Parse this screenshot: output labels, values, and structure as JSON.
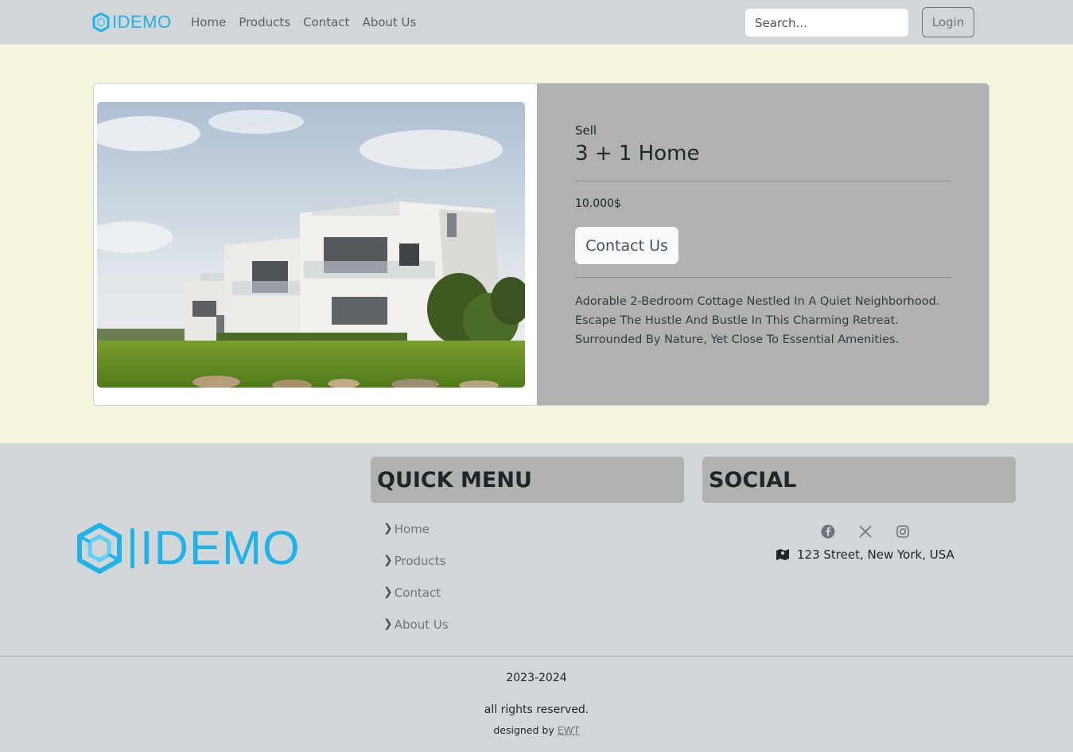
{
  "navbar": {
    "brand": "IDEMO",
    "links": [
      "Home",
      "Products",
      "Contact",
      "About Us"
    ],
    "search_placeholder": "Search...",
    "login_label": "Login"
  },
  "listing": {
    "category": "Sell",
    "title": "3 + 1 Home",
    "price": "10.000$",
    "contact_label": "Contact Us",
    "description": "Adorable 2-Bedroom Cottage Nestled In A Quiet Neighborhood. Escape The Hustle And Bustle In This Charming Retreat. Surrounded By Nature, Yet Close To Essential Amenities."
  },
  "footer": {
    "brand": "IDEMO",
    "quick_menu_title": "QUICK MENU",
    "quick_menu": [
      "Home",
      "Products",
      "Contact",
      "About Us"
    ],
    "social_title": "SOCIAL",
    "social_icons": [
      "facebook-icon",
      "x-icon",
      "instagram-icon"
    ],
    "address": "123 Street, New York, USA",
    "years": "2023-2024",
    "rights": "all rights reserved.",
    "designed_by_prefix": "designed by",
    "designed_by_link": "EWT"
  },
  "colors": {
    "brand": "#1fb3e8",
    "page_bg": "#f5f5dc",
    "nav_bg": "#d3d6d8",
    "card_body_bg": "#b0b2b1"
  }
}
